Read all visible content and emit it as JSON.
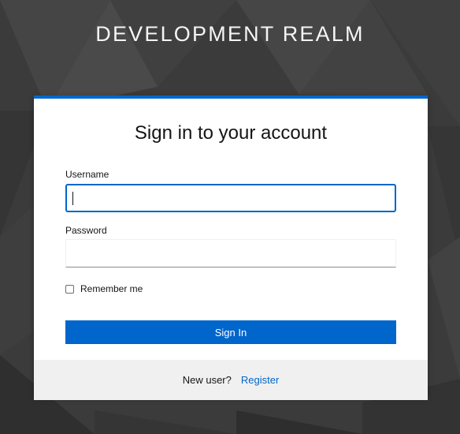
{
  "realm": {
    "title": "DEVELOPMENT REALM"
  },
  "login": {
    "heading": "Sign in to your account",
    "username": {
      "label": "Username",
      "value": ""
    },
    "password": {
      "label": "Password",
      "value": ""
    },
    "remember": {
      "label": "Remember me",
      "checked": false
    },
    "submit_label": "Sign In"
  },
  "footer": {
    "new_user_text": "New user?",
    "register_label": "Register"
  },
  "colors": {
    "accent": "#0066cc",
    "background": "#3a3a3a",
    "footer_bg": "#f0f0f0"
  }
}
